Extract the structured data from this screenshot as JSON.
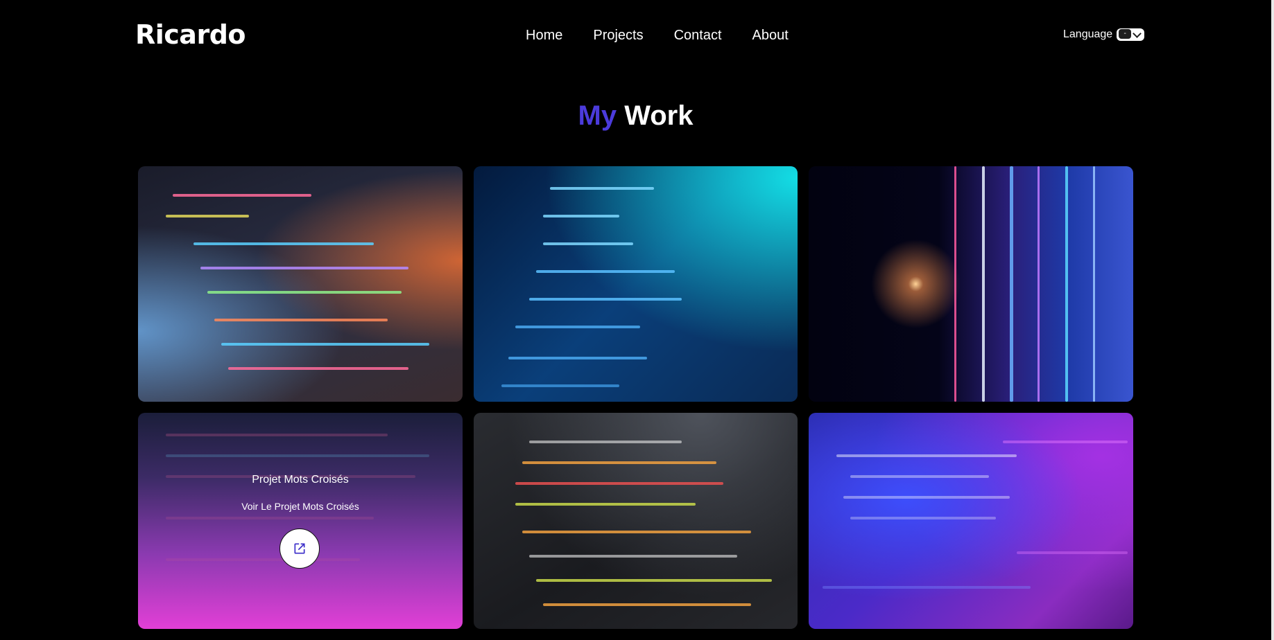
{
  "header": {
    "logo": "Ricardo",
    "nav": [
      "Home",
      "Projects",
      "Contact",
      "About"
    ],
    "language_label": "Language",
    "language_value": "-"
  },
  "section": {
    "title_accent": "My",
    "title_rest": "Work"
  },
  "projects": [
    {
      "title": "Projet Mots Croisés",
      "link_label": "Voir Le Projet Mots Croisés",
      "icon": "external-link-icon"
    }
  ],
  "colors": {
    "background": "#000000",
    "accent": "#4b3bdb",
    "link_icon": "#3a2cc9"
  }
}
